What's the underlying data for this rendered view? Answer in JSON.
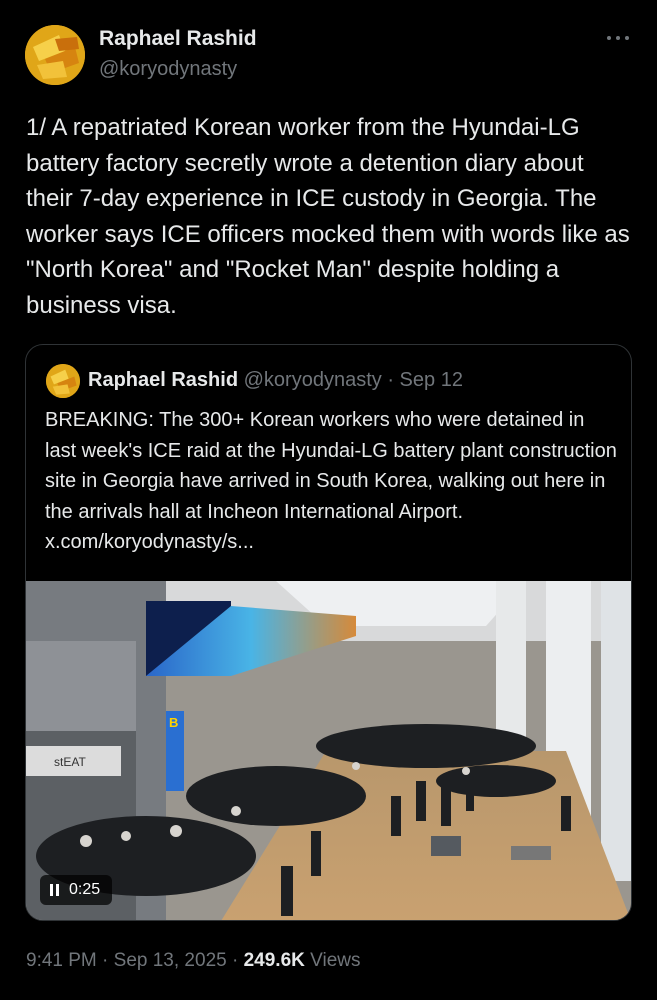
{
  "author": {
    "name": "Raphael Rashid",
    "handle": "@koryodynasty"
  },
  "tweet": {
    "text": "1/ A repatriated Korean worker from the Hyundai-LG battery factory secretly wrote a detention diary about their 7-day experience in ICE custody in Georgia. The worker says ICE officers mocked them with words like as \"North Korea\" and \"Rocket Man\" despite holding a business visa.",
    "time": "9:41 PM",
    "date": "Sep 13, 2025",
    "views_count": "249.6K",
    "views_label": "Views",
    "separator": "·"
  },
  "quote": {
    "name": "Raphael Rashid",
    "handle": "@koryodynasty",
    "date": "Sep 12",
    "separator": "·",
    "text": "BREAKING: The 300+ Korean workers who were detained in last week's ICE raid at the Hyundai-LG battery plant construction site in Georgia have arrived in South Korea, walking out here in the arrivals hall at Incheon International Airport.  x.com/koryodynasty/s...",
    "video_duration": "0:25",
    "scene_sign": "B",
    "scene_store": "stEAT"
  },
  "icons": {
    "more": "more-horizontal-icon",
    "pause": "pause-icon"
  }
}
